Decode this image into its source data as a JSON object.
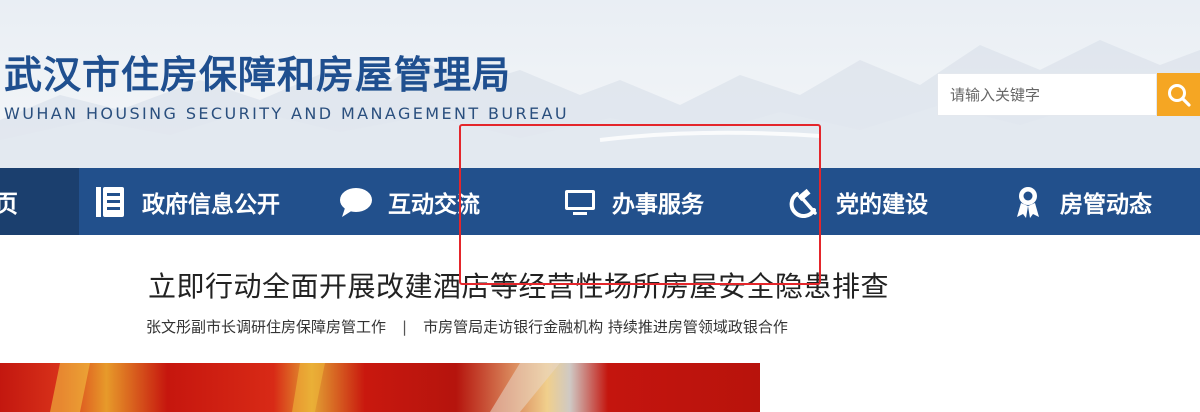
{
  "header": {
    "title_cn": "武汉市住房保障和房屋管理局",
    "title_en": "WUHAN HOUSING SECURITY AND MANAGEMENT BUREAU"
  },
  "search": {
    "placeholder": "请输入关键字",
    "button_icon": "search-icon"
  },
  "nav": {
    "home_label": "页",
    "items": [
      {
        "label": "政府信息公开",
        "icon": "document-list-icon"
      },
      {
        "label": "互动交流",
        "icon": "chat-bubble-icon"
      },
      {
        "label": "办事服务",
        "icon": "monitor-icon"
      },
      {
        "label": "党的建设",
        "icon": "hammer-sickle-icon"
      },
      {
        "label": "房管动态",
        "icon": "award-ribbon-icon"
      }
    ]
  },
  "news": {
    "headline": "立即行动全面开展改建酒店等经营性场所房屋安全隐患排查",
    "sub_left": "张文彤副市长调研住房保障房管工作",
    "separator": "|",
    "sub_right": "市房管局走访银行金融机构 持续推进房管领域政银合作"
  },
  "colors": {
    "nav_bg": "#22508c",
    "nav_home_bg": "#1b3f6e",
    "title_blue": "#1f4f8f",
    "search_button": "#f5a623",
    "annotation_red": "#e4262b"
  }
}
